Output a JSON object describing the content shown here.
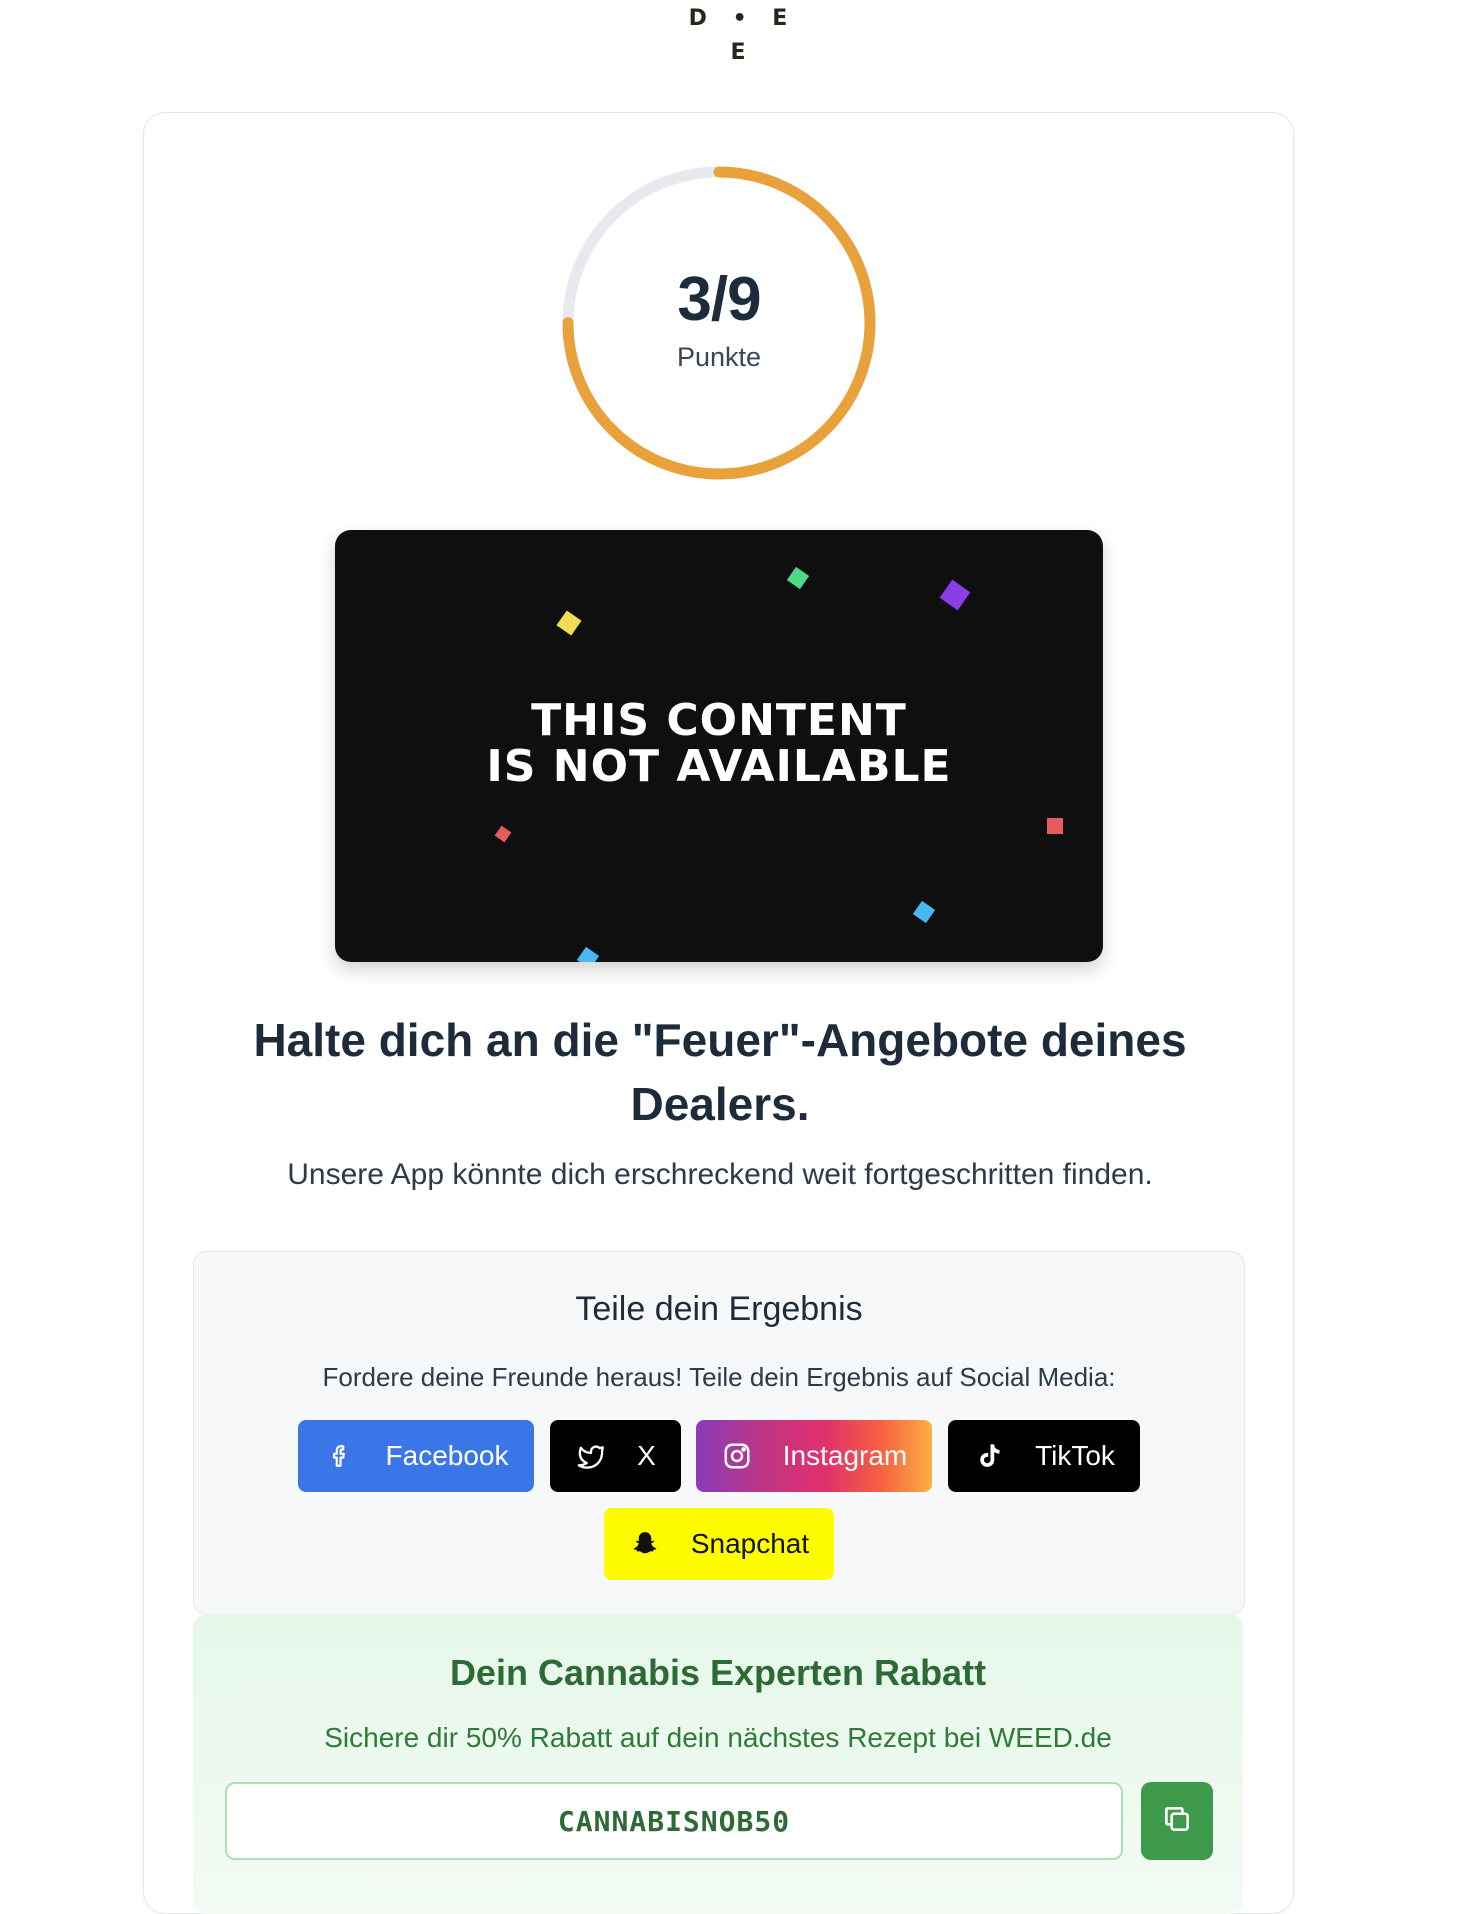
{
  "logo": {
    "row1": "D • E",
    "row2": "E"
  },
  "score": {
    "value": "3/9",
    "label": "Punkte",
    "progress": 0.333,
    "ring_color": "#e9a23b",
    "track_color": "#e8e9ee"
  },
  "media": {
    "line1": "THIS CONTENT",
    "line2": "IS NOT AVAILABLE"
  },
  "result": {
    "headline": "Halte dich an die \"Feuer\"-Angebote deines Dealers.",
    "subline": "Unsere App könnte dich erschreckend weit fortgeschritten finden."
  },
  "share": {
    "title": "Teile dein Ergebnis",
    "description": "Fordere deine Freunde heraus! Teile dein Ergebnis auf Social Media:",
    "buttons": {
      "facebook": {
        "label": "Facebook",
        "icon": "facebook-icon",
        "color": "#3b76e8"
      },
      "x": {
        "label": "X",
        "icon": "twitter-bird-icon",
        "color": "#000000"
      },
      "instagram": {
        "label": "Instagram",
        "icon": "instagram-icon"
      },
      "tiktok": {
        "label": "TikTok",
        "icon": "tiktok-icon",
        "color": "#000000"
      },
      "snapchat": {
        "label": "Snapchat",
        "icon": "snapchat-ghost-icon",
        "color": "#fffc00"
      }
    }
  },
  "promo": {
    "title": "Dein Cannabis Experten Rabatt",
    "description": "Sichere dir 50% Rabatt auf dein nächstes Rezept bei WEED.de",
    "code": "CANNABISNOB50",
    "copy_icon": "copy-icon"
  }
}
